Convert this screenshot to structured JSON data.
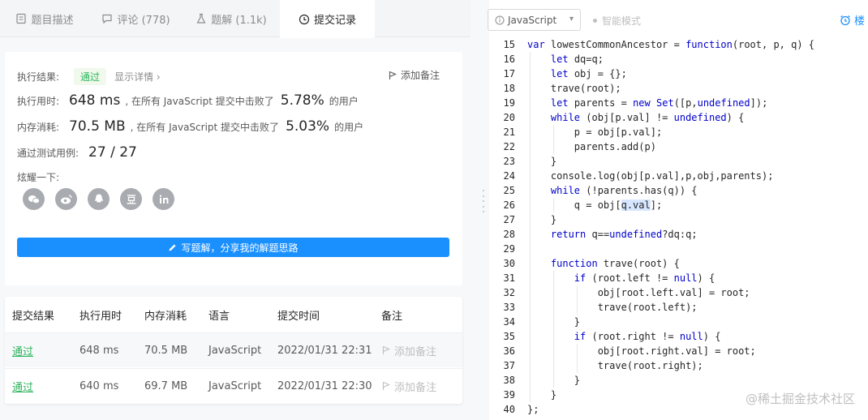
{
  "tabs": [
    {
      "label": "题目描述",
      "icon": "document-icon"
    },
    {
      "label": "评论 (778)",
      "icon": "comment-icon"
    },
    {
      "label": "题解 (1.1k)",
      "icon": "flask-icon"
    },
    {
      "label": "提交记录",
      "icon": "clock-icon"
    }
  ],
  "result": {
    "status_label": "执行结果:",
    "status_value": "通过",
    "detail_link": "显示详情 ›",
    "add_note": "添加备注",
    "runtime_label": "执行用时:",
    "runtime_value": "648 ms",
    "runtime_text": ", 在所有 JavaScript 提交中击败了",
    "runtime_pct": "5.78%",
    "users_suffix": "的用户",
    "memory_label": "内存消耗:",
    "memory_value": "70.5 MB",
    "memory_text": ", 在所有 JavaScript 提交中击败了",
    "memory_pct": "5.03%",
    "cases_label": "通过测试用例:",
    "cases_value": "27 / 27",
    "share_label": "炫耀一下:",
    "share_icons": [
      "wechat-icon",
      "weibo-icon",
      "qq-icon",
      "douban-icon",
      "linkedin-icon"
    ],
    "write_button": "写题解，分享我的解题思路"
  },
  "history": {
    "headers": [
      "提交结果",
      "执行用时",
      "内存消耗",
      "语言",
      "提交时间",
      "备注"
    ],
    "rows": [
      {
        "status": "通过",
        "time": "648 ms",
        "memory": "70.5 MB",
        "lang": "JavaScript",
        "date": "2022/01/31 22:31",
        "note": "添加备注"
      },
      {
        "status": "通过",
        "time": "640 ms",
        "memory": "69.7 MB",
        "lang": "JavaScript",
        "date": "2022/01/31 22:30",
        "note": "添加备注"
      }
    ]
  },
  "editor": {
    "language": "JavaScript",
    "smart_mode": "智能模式",
    "clock_label": "楼",
    "lines": [
      {
        "n": "15",
        "t": "var lowestCommonAncestor = function(root, p, q) {"
      },
      {
        "n": "16",
        "t": "    let dq=q;"
      },
      {
        "n": "17",
        "t": "    let obj = {};"
      },
      {
        "n": "18",
        "t": "    trave(root);"
      },
      {
        "n": "19",
        "t": "    let parents = new Set([p,undefined]);"
      },
      {
        "n": "20",
        "t": "    while (obj[p.val] != undefined) {"
      },
      {
        "n": "21",
        "t": "        p = obj[p.val];"
      },
      {
        "n": "22",
        "t": "        parents.add(p)"
      },
      {
        "n": "23",
        "t": "    }"
      },
      {
        "n": "24",
        "t": "    console.log(obj[p.val],p,obj,parents);"
      },
      {
        "n": "25",
        "t": "    while (!parents.has(q)) {"
      },
      {
        "n": "26",
        "t": "        q = obj[q.val];"
      },
      {
        "n": "27",
        "t": "    }"
      },
      {
        "n": "28",
        "t": "    return q==undefined?dq:q;"
      },
      {
        "n": "29",
        "t": ""
      },
      {
        "n": "30",
        "t": "    function trave(root) {"
      },
      {
        "n": "31",
        "t": "        if (root.left != null) {"
      },
      {
        "n": "32",
        "t": "            obj[root.left.val] = root;"
      },
      {
        "n": "33",
        "t": "            trave(root.left);"
      },
      {
        "n": "34",
        "t": "        }"
      },
      {
        "n": "35",
        "t": "        if (root.right != null) {"
      },
      {
        "n": "36",
        "t": "            obj[root.right.val] = root;"
      },
      {
        "n": "37",
        "t": "            trave(root.right);"
      },
      {
        "n": "38",
        "t": "        }"
      },
      {
        "n": "39",
        "t": "    }"
      },
      {
        "n": "40",
        "t": "};"
      }
    ]
  },
  "watermark": "@稀土掘金技术社区",
  "colors": {
    "accent": "#1a90ff",
    "pass": "#2db55d",
    "keyword": "#0000cc"
  }
}
